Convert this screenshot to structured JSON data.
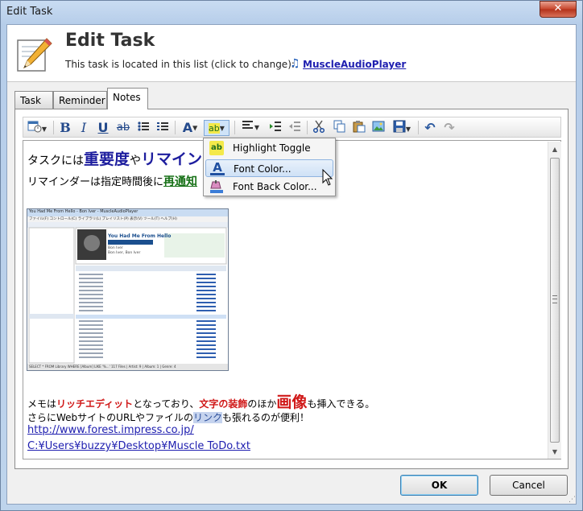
{
  "window": {
    "title": "Edit Task",
    "close_glyph": "✕"
  },
  "header": {
    "title": "Edit Task",
    "subtitle": "This task is located in this list (click to change):",
    "list_link": "MuscleAudioPlayer",
    "icon": "pencil-paper-icon",
    "list_icon": "music-note-icon"
  },
  "tabs": [
    {
      "label": "Task",
      "active": false
    },
    {
      "label": "Reminder",
      "active": false
    },
    {
      "label": "Notes",
      "active": true
    }
  ],
  "toolbar": {
    "bold": "B",
    "italic": "I",
    "underline": "U",
    "strike": "ab",
    "font_color": "A",
    "highlight": "ab",
    "icons": [
      "insert-datetime-icon",
      "bold-icon",
      "italic-icon",
      "underline-icon",
      "strikethrough-icon",
      "bullet-list-icon",
      "numbered-list-icon",
      "font-color-icon",
      "highlight-icon",
      "align-icon",
      "indent-icon",
      "outdent-icon",
      "cut-icon",
      "copy-icon",
      "paste-icon",
      "image-icon",
      "save-icon",
      "undo-icon",
      "redo-icon"
    ]
  },
  "editor": {
    "line1": {
      "a": "タスクには",
      "b": "重要度",
      "c": "や",
      "d": "リマイン"
    },
    "line2": {
      "a": "リマインダーは指定時間後に",
      "b": "再通知"
    },
    "line3": {
      "a": "メモは",
      "b": "リッチエディット",
      "c": "となっており、",
      "d": "文字の装飾",
      "e": "のほか",
      "f": "画像",
      "g": "も挿入できる。"
    },
    "line4": {
      "a": "さらにWebサイトのURLやファイルの",
      "b": "リンク",
      "c": "も張れるのが便利！"
    },
    "url": "http://www.forest.impress.co.jp/",
    "file_path": "C:¥Users¥buzzy¥Desktop¥Muscle ToDo.txt"
  },
  "embedded_image": {
    "window_title": "You Had Me From Hello - Bon Iver - MuscleAudioPlayer",
    "menu": "ファイル(F)  コントロール(C)  ライブラリ(L)  プレイリスト(P)  表示(V)  ツール(T)  ヘルプ(H)",
    "now_playing": "You Had Me From Hello",
    "artist": "Bon Iver",
    "album": "Bon Iver, Bon Iver",
    "status": "SELECT * FROM Library WHERE [Album] LIKE '%...'   117 Files | Artist: 9 | Album: 1 | Genre: 4"
  },
  "format_menu": {
    "items": [
      {
        "label": "Highlight Toggle",
        "icon": "highlight-toggle-icon",
        "hovered": false
      },
      {
        "label": "Font Color...",
        "icon": "font-color-icon",
        "hovered": true
      },
      {
        "label": "Font Back Color...",
        "icon": "font-back-color-icon",
        "hovered": false
      }
    ]
  },
  "buttons": {
    "ok": "OK",
    "cancel": "Cancel"
  }
}
